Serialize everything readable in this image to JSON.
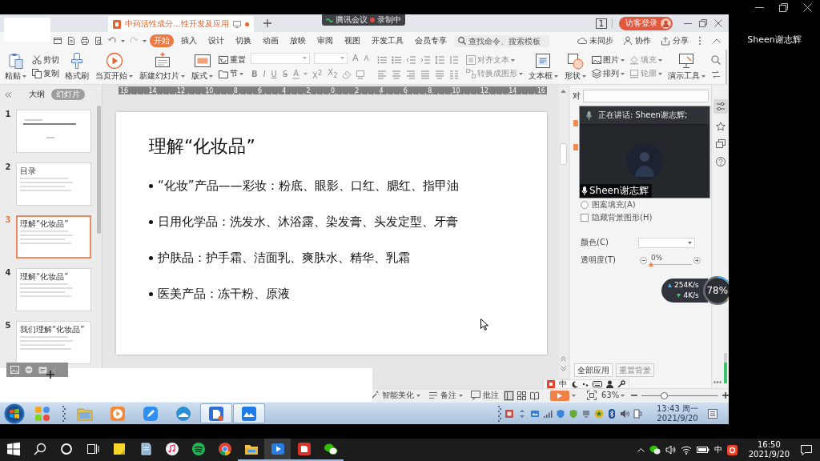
{
  "meeting": {
    "presenter": "Sheen谢志辉"
  },
  "recording_badge": {
    "app": "腾讯会议",
    "status": "录制中"
  },
  "wps": {
    "document_tab": {
      "title": "中药活性成分...性开发及应用",
      "unsaved": true
    },
    "window_count": "1",
    "login_button": "访客登录",
    "menu_tabs": [
      {
        "label": "开始",
        "selected": true
      },
      {
        "label": "插入",
        "selected": false
      },
      {
        "label": "设计",
        "selected": false
      },
      {
        "label": "切换",
        "selected": false
      },
      {
        "label": "动画",
        "selected": false
      },
      {
        "label": "放映",
        "selected": false
      },
      {
        "label": "审阅",
        "selected": false
      },
      {
        "label": "视图",
        "selected": false
      },
      {
        "label": "开发工具",
        "selected": false
      },
      {
        "label": "会员专享",
        "selected": false
      }
    ],
    "search": {
      "placeholder": "查找命令、搜索模板"
    },
    "menu_actions": [
      "未同步",
      "协作",
      "分享"
    ],
    "ribbon": [
      {
        "kind": "large",
        "label": "粘贴",
        "dropdown": true,
        "disabled": false
      },
      {
        "kind": "stack",
        "tools": [
          {
            "label": "剪切",
            "dropdown": false,
            "disabled": false
          },
          {
            "label": "复制",
            "dropdown": false,
            "disabled": false
          }
        ]
      },
      {
        "kind": "large",
        "label": "格式刷",
        "dropdown": false,
        "disabled": false
      },
      {
        "kind": "large",
        "label": "当页开始",
        "dropdown": true,
        "disabled": false
      },
      {
        "kind": "large",
        "label": "新建幻灯片",
        "dropdown": true,
        "disabled": false
      },
      {
        "kind": "large",
        "label": "版式",
        "dropdown": true,
        "disabled": false
      },
      {
        "kind": "stack",
        "tools": [
          {
            "label": "重置",
            "dropdown": false,
            "disabled": false
          },
          {
            "label": "节",
            "dropdown": true,
            "disabled": false
          }
        ]
      },
      {
        "kind": "font",
        "disabled": true,
        "size_buttons": [
          {
            "label": "A",
            "kind": "grow"
          },
          {
            "label": "A",
            "kind": "shrink"
          }
        ],
        "buttons": [
          {
            "label": "B",
            "kind": "bold"
          },
          {
            "label": "I",
            "kind": "italic"
          },
          {
            "label": "U",
            "kind": "underline"
          },
          {
            "label": "S",
            "kind": "strike"
          },
          {
            "label": "A",
            "kind": "color"
          },
          {
            "label": "X$^{2}$",
            "kind": "plain"
          },
          {
            "label": "X$_{2}$",
            "kind": "plain"
          }
        ]
      },
      {
        "kind": "paragraph"
      },
      {
        "kind": "stack",
        "tools": [
          {
            "label": "对齐文本",
            "dropdown": true,
            "disabled": true
          },
          {
            "label": "转换成图形",
            "dropdown": true,
            "disabled": true
          }
        ]
      },
      {
        "kind": "large",
        "label": "文本框",
        "dropdown": true,
        "disabled": false
      },
      {
        "kind": "large",
        "label": "形状",
        "dropdown": true,
        "disabled": false
      },
      {
        "kind": "stack",
        "tools": [
          {
            "label": "图片",
            "dropdown": true,
            "disabled": false
          },
          {
            "label": "排列",
            "dropdown": true,
            "disabled": false
          }
        ]
      },
      {
        "kind": "stack",
        "tools": [
          {
            "label": "填充",
            "dropdown": true,
            "disabled": true
          },
          {
            "label": "轮廓",
            "dropdown": true,
            "disabled": true
          }
        ]
      },
      {
        "kind": "large",
        "label": "演示工具",
        "dropdown": true,
        "disabled": false
      },
      {
        "kind": "cut"
      }
    ],
    "ruler_labels": [
      "16",
      "14",
      "12",
      "10",
      "8",
      "6",
      "4",
      "2",
      "0",
      "2",
      "4",
      "6",
      "8",
      "10",
      "12",
      "14",
      "16"
    ],
    "slide_panel": {
      "views": [
        {
          "label": "大纲",
          "selected": false
        },
        {
          "label": "幻灯片",
          "selected": true
        }
      ],
      "slides": [
        {
          "number": "1",
          "selected": false
        },
        {
          "number": "2",
          "selected": false,
          "title": "目录"
        },
        {
          "number": "3",
          "selected": true,
          "title": "理解“化妆品”"
        },
        {
          "number": "4",
          "selected": false,
          "title": "理解“化妆品”"
        },
        {
          "number": "5",
          "selected": false,
          "title": "我们理解“化妆品”"
        }
      ]
    },
    "slide": {
      "title": "理解“化妆品”",
      "bullets": [
        "“化妆”产品——彩妆：粉底、眼影、口红、腮红、指甲油",
        "日用化学品：洗发水、沐浴露、染发膏、头发定型、牙膏",
        "护肤品：护手霜、洁面乳、爽肤水、精华、乳霜",
        "医美产品：冻干粉、原液"
      ]
    },
    "properties_pane": {
      "heading": "对",
      "options": [
        {
          "kind": "radio",
          "label": "图案填充(A)",
          "checked": false
        },
        {
          "kind": "checkbox",
          "label": "隐藏背景图形(H)",
          "checked": false
        }
      ],
      "color": {
        "label": "颜色(C)"
      },
      "transparency": {
        "label": "透明度(T)",
        "reading": "0%",
        "level": 0
      },
      "buttons": [
        {
          "label": "全部应用",
          "disabled": false
        },
        {
          "label": "重置背景",
          "disabled": true
        }
      ]
    },
    "status_bar": {
      "beautify": "智能美化",
      "notes": "备注",
      "comments": "批注",
      "views": [
        {
          "selected": true
        },
        {
          "selected": false
        },
        {
          "selected": false
        }
      ],
      "zoom": {
        "reading": "63%",
        "level": 0.28
      }
    },
    "ime_bar": {
      "mode": "中"
    }
  },
  "video_tile": {
    "speaking": "正在讲话: Sheen谢志辉;",
    "name": "Sheen谢志辉"
  },
  "network_monitor": {
    "upload": "254K/s",
    "download": "4K/s",
    "usage": "78%"
  },
  "win7_taskbar": {
    "apps": [
      {
        "selected": false
      },
      {
        "selected": false
      },
      {
        "selected": false
      },
      {
        "selected": false
      },
      {
        "selected": false
      },
      {
        "selected": true
      },
      {
        "selected": true
      }
    ],
    "time": "13:43 周一",
    "date": "2021/9/20"
  },
  "win10_taskbar": {
    "apps": [
      {
        "selected": false,
        "running": false
      },
      {
        "selected": false,
        "running": false
      },
      {
        "selected": false,
        "running": false
      },
      {
        "selected": false,
        "running": false
      },
      {
        "selected": false,
        "running": false
      },
      {
        "selected": false,
        "running": true
      },
      {
        "selected": true,
        "running": true
      },
      {
        "selected": false,
        "running": true
      },
      {
        "selected": false,
        "running": true
      }
    ],
    "input_mode": "中",
    "time": "16:50",
    "date": "2021/9/20"
  }
}
